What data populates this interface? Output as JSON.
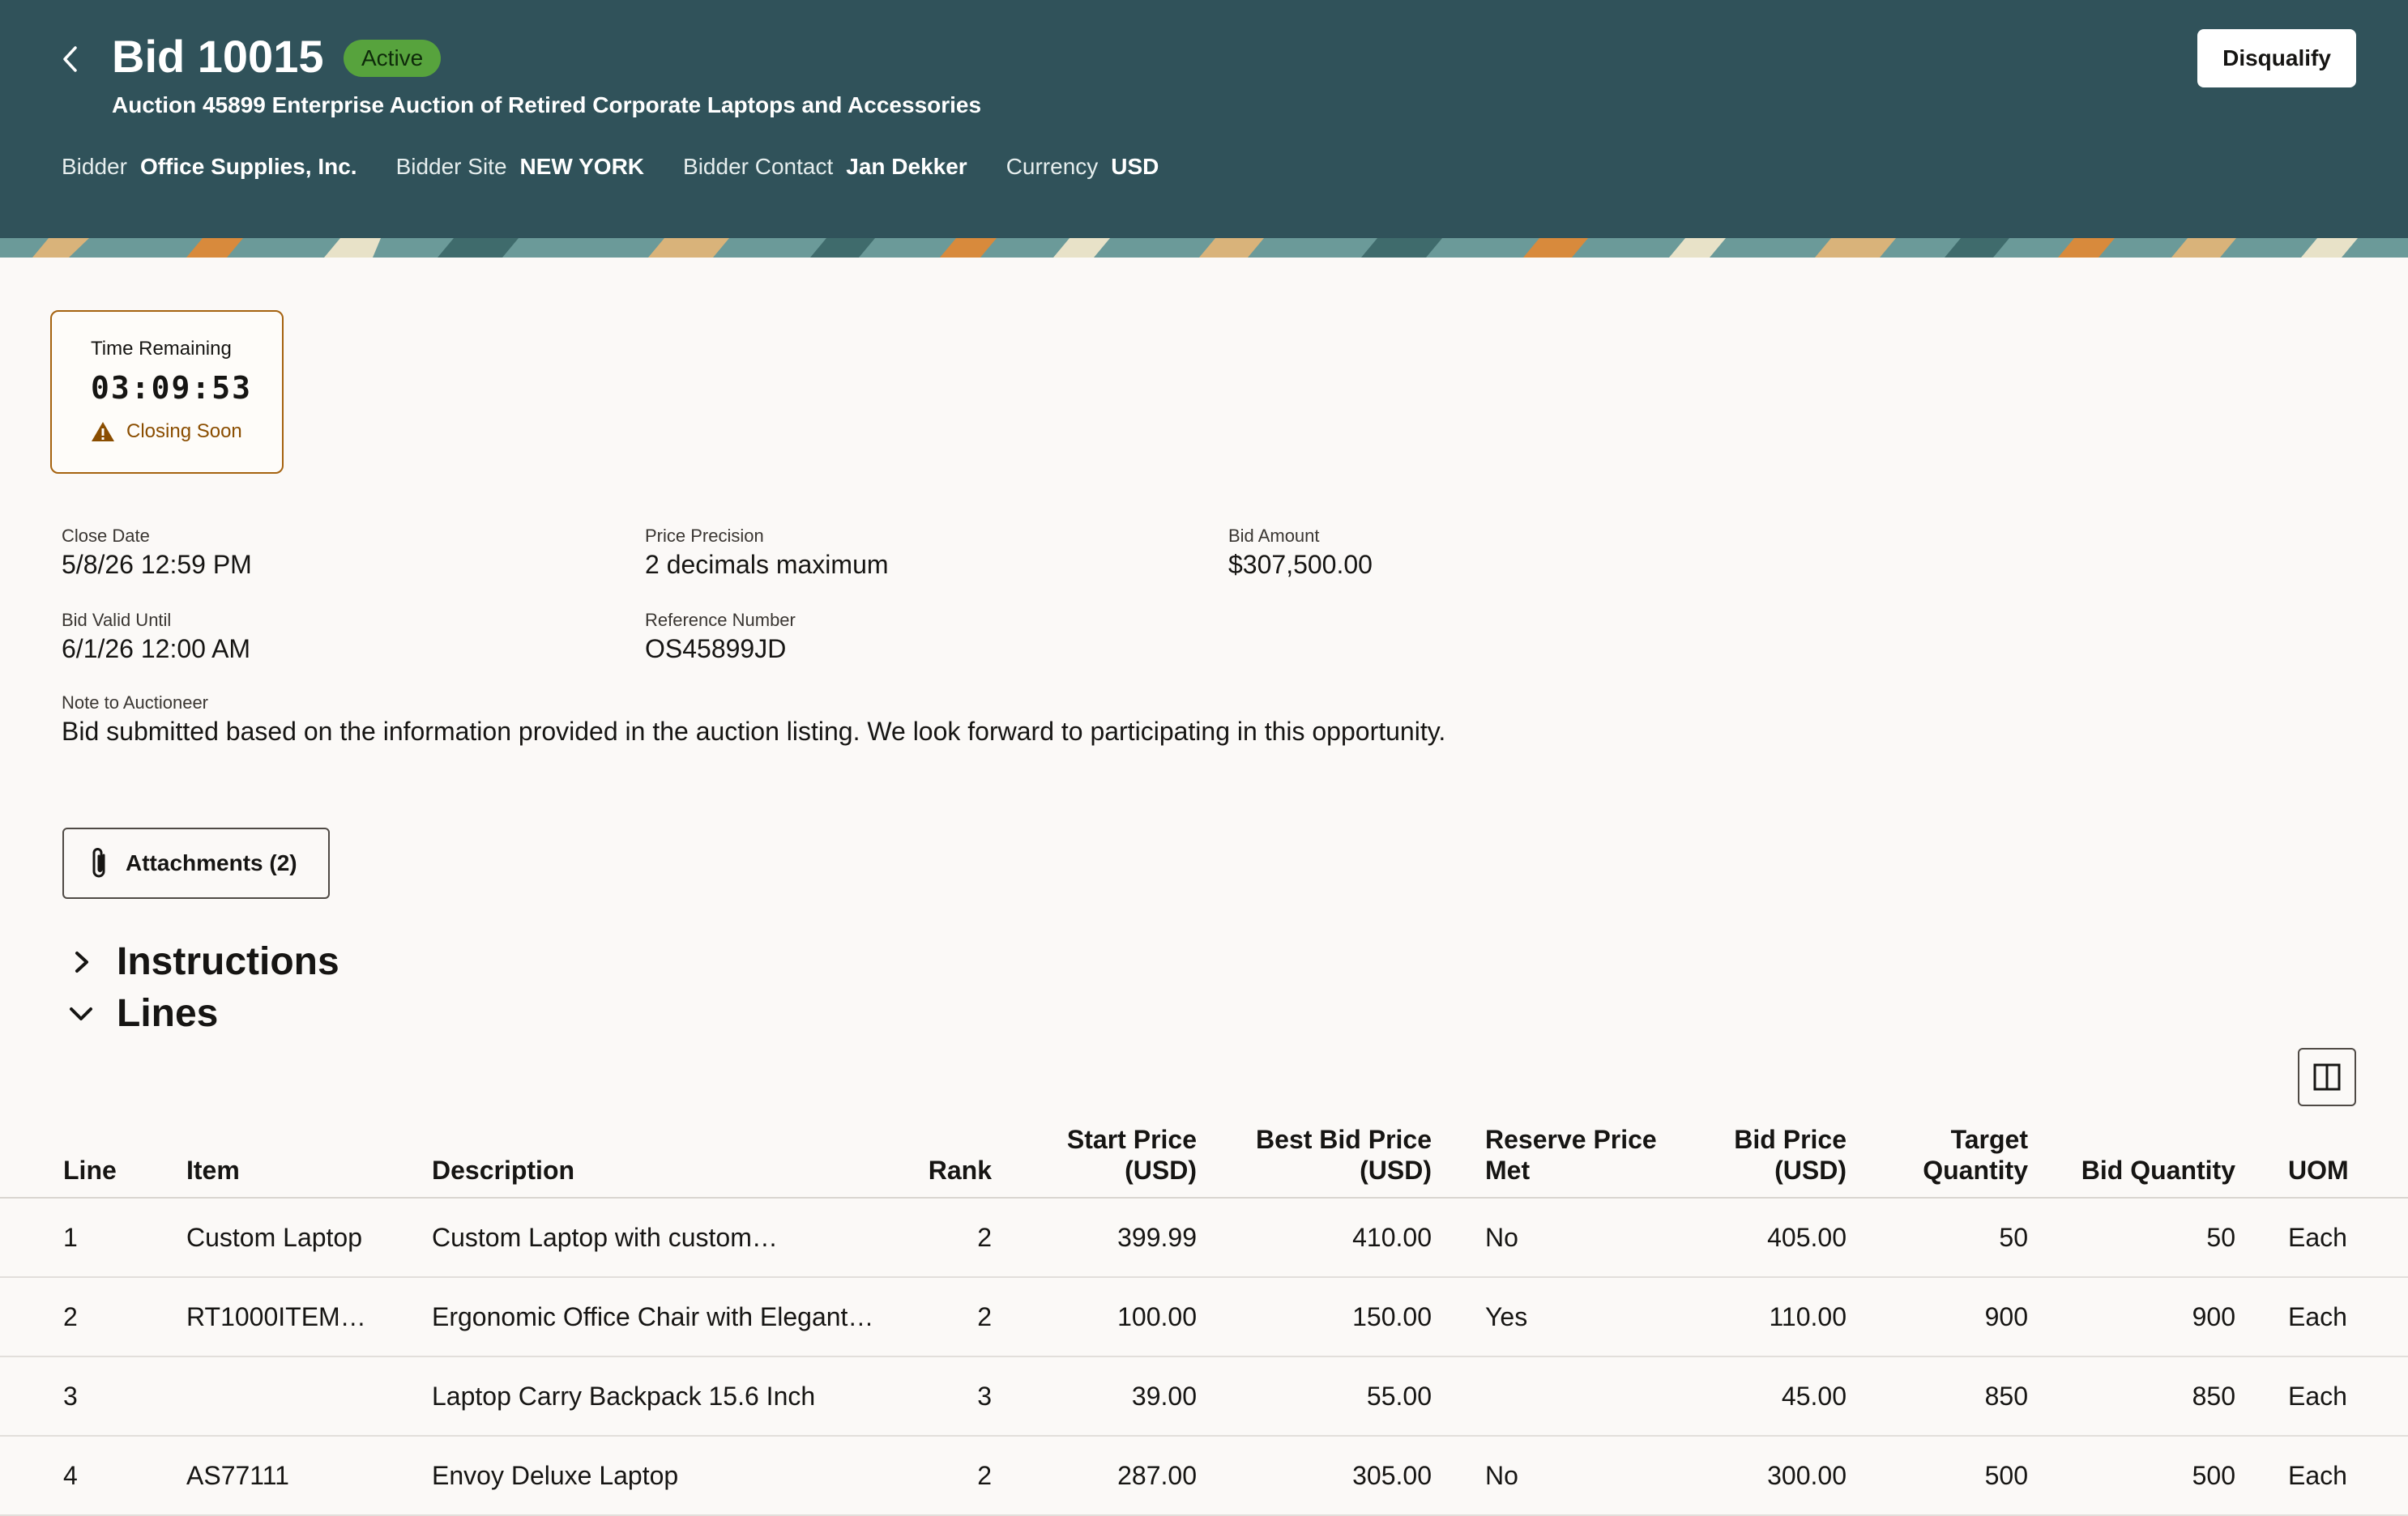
{
  "header": {
    "title": "Bid 10015",
    "status": "Active",
    "subtitle": "Auction 45899 Enterprise Auction of Retired Corporate Laptops and Accessories",
    "meta": [
      {
        "label": "Bidder",
        "value": "Office Supplies, Inc."
      },
      {
        "label": "Bidder Site",
        "value": "NEW YORK"
      },
      {
        "label": "Bidder Contact",
        "value": "Jan Dekker"
      },
      {
        "label": "Currency",
        "value": "USD"
      }
    ],
    "disqualify_label": "Disqualify",
    "colors": {
      "background": "#30525a",
      "status_badge": "#57a33d"
    }
  },
  "time_card": {
    "label": "Time Remaining",
    "value": "03:09:53",
    "warning": "Closing Soon",
    "border_color": "#a5620f"
  },
  "fields": {
    "close_date": {
      "label": "Close Date",
      "value": "5/8/26 12:59 PM"
    },
    "price_precision": {
      "label": "Price Precision",
      "value": "2 decimals maximum"
    },
    "bid_amount": {
      "label": "Bid Amount",
      "value": "$307,500.00"
    },
    "bid_valid_until": {
      "label": "Bid Valid Until",
      "value": "6/1/26 12:00 AM"
    },
    "reference_number": {
      "label": "Reference Number",
      "value": "OS45899JD"
    },
    "note": {
      "label": "Note to Auctioneer",
      "value": "Bid submitted based on the information provided in the auction listing. We look forward to participating in this opportunity."
    }
  },
  "attachments": {
    "label": "Attachments (2)"
  },
  "sections": {
    "instructions": "Instructions",
    "lines": "Lines"
  },
  "table": {
    "headers": {
      "line": "Line",
      "item": "Item",
      "description": "Description",
      "rank": "Rank",
      "start_price": "Start Price (USD)",
      "best_bid_price": "Best Bid Price (USD)",
      "reserve_price_met": "Reserve Price Met",
      "bid_price": "Bid Price (USD)",
      "target_quantity": "Target Quantity",
      "bid_quantity": "Bid Quantity",
      "uom": "UOM"
    },
    "rows": [
      {
        "line": "1",
        "item": "Custom Laptop",
        "description": "Custom Laptop with custom…",
        "rank": "2",
        "start_price": "399.99",
        "best_bid_price": "410.00",
        "reserve_price_met": "No",
        "bid_price": "405.00",
        "target_quantity": "50",
        "bid_quantity": "50",
        "uom": "Each"
      },
      {
        "line": "2",
        "item": "RT1000ITEM…",
        "description": "Ergonomic Office Chair with Elegant…",
        "rank": "2",
        "start_price": "100.00",
        "best_bid_price": "150.00",
        "reserve_price_met": "Yes",
        "bid_price": "110.00",
        "target_quantity": "900",
        "bid_quantity": "900",
        "uom": "Each"
      },
      {
        "line": "3",
        "item": "",
        "description": "Laptop Carry Backpack 15.6 Inch",
        "rank": "3",
        "start_price": "39.00",
        "best_bid_price": "55.00",
        "reserve_price_met": "",
        "bid_price": "45.00",
        "target_quantity": "850",
        "bid_quantity": "850",
        "uom": "Each"
      },
      {
        "line": "4",
        "item": "AS77111",
        "description": "Envoy Deluxe Laptop",
        "rank": "2",
        "start_price": "287.00",
        "best_bid_price": "305.00",
        "reserve_price_met": "No",
        "bid_price": "300.00",
        "target_quantity": "500",
        "bid_quantity": "500",
        "uom": "Each"
      }
    ]
  }
}
